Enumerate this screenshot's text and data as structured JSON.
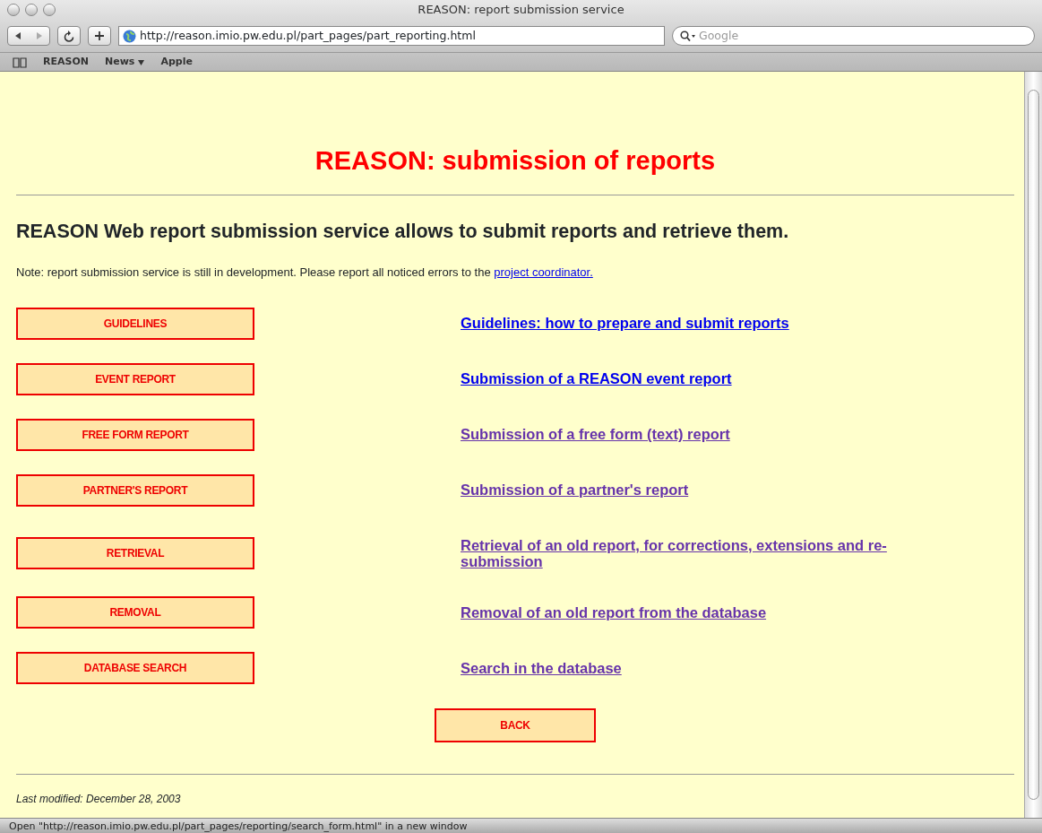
{
  "window": {
    "title": "REASON: report submission service"
  },
  "toolbar": {
    "address": "http://reason.imio.pw.edu.pl/part_pages/part_reporting.html",
    "search_placeholder": "Google"
  },
  "bookmarks": [
    {
      "label": "REASON",
      "menu": false
    },
    {
      "label": "News",
      "menu": true
    },
    {
      "label": "Apple",
      "menu": false
    }
  ],
  "page": {
    "title": "REASON: submission of reports",
    "intro": "REASON Web report submission service allows to submit reports and retrieve them.",
    "note": "Note: report submission service is still in development. Please report all noticed errors to the",
    "note_link": "project coordinator.",
    "rows": [
      {
        "button": "GUIDELINES",
        "link": "Guidelines: how to prepare and submit reports",
        "visited": false
      },
      {
        "button": "EVENT REPORT",
        "link": "Submission of a REASON event report",
        "visited": false
      },
      {
        "button": "FREE FORM REPORT",
        "link": "Submission of a free form (text) report",
        "visited": true
      },
      {
        "button": "PARTNER'S REPORT",
        "link": "Submission of a partner's report",
        "visited": true
      },
      {
        "button": "RETRIEVAL",
        "link": "Retrieval of an old report, for corrections, extensions and re-submission",
        "visited": true
      },
      {
        "button": "REMOVAL",
        "link": "Removal of an old report from the database",
        "visited": true
      },
      {
        "button": "DATABASE SEARCH",
        "link": "Search in the database",
        "visited": true
      }
    ],
    "back": "BACK",
    "modified": "Last modified: December 28, 2003"
  },
  "status_bar": "Open \"http://reason.imio.pw.edu.pl/part_pages/reporting/search_form.html\" in a new window"
}
